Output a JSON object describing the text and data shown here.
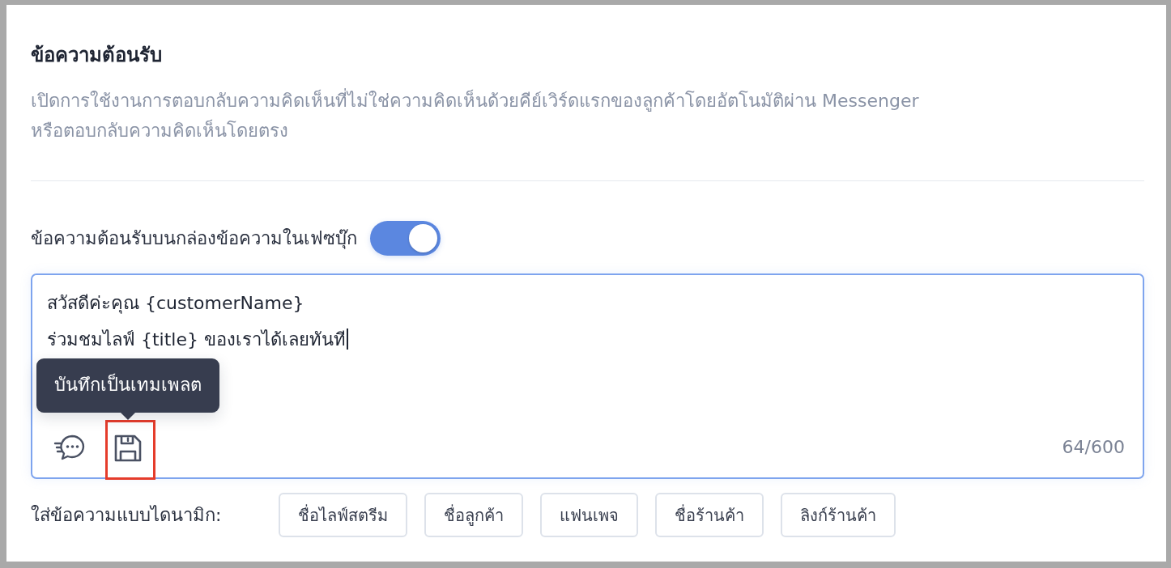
{
  "section": {
    "title": "ข้อความต้อนรับ",
    "description": "เปิดการใช้งานการตอบกลับความคิดเห็นที่ไม่ใช่ความคิดเห็นด้วยคีย์เวิร์ดแรกของลูกค้าโดยอัตโนมัติผ่าน Messenger หรือตอบกลับความคิดเห็นโดยตรง"
  },
  "toggle": {
    "label": "ข้อความต้อนรับบนกล่องข้อความในเฟซบุ๊ก",
    "on": true
  },
  "editor": {
    "value": "สวัสดีค่ะคุณ {customerName}\nร่วมชมไลฟ์ {title} ของเราได้เลยทันที",
    "focused": true,
    "tools": [
      {
        "kind": "quick-reply",
        "highlighted": false
      },
      {
        "kind": "save-template",
        "highlighted": true,
        "tooltip": "บันทึกเป็นเทมเพลต"
      }
    ],
    "counter": "64/600"
  },
  "dynamic_fields": {
    "label": "ใส่ข้อความแบบไดนามิก:",
    "chips": [
      "ชื่อไลฟ์สตรีม",
      "ชื่อลูกค้า",
      "แฟนเพจ",
      "ชื่อร้านค้า",
      "ลิงก์ร้านค้า"
    ]
  }
}
